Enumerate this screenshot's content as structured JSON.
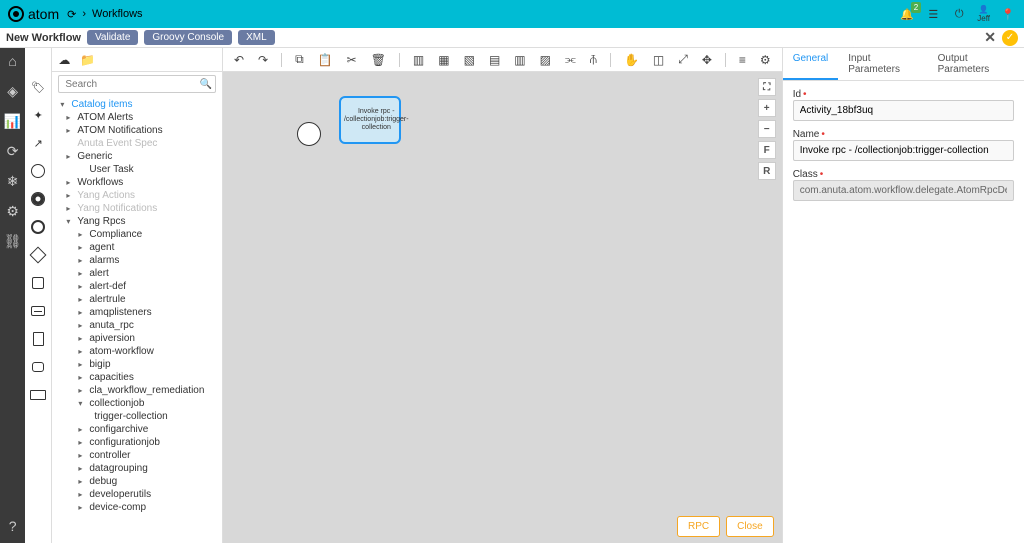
{
  "header": {
    "logo_text": "atom",
    "breadcrumb_sep": "›",
    "breadcrumb_item": "Workflows",
    "notif_count": "2",
    "user_name": "Jeff"
  },
  "tabbar": {
    "title": "New Workflow",
    "btn_validate": "Validate",
    "btn_groovy": "Groovy Console",
    "btn_xml": "XML"
  },
  "search": {
    "placeholder": "Search"
  },
  "tree": {
    "root": "Catalog items",
    "items_lvl1": [
      {
        "label": "ATOM Alerts",
        "caret": "▸"
      },
      {
        "label": "ATOM Notifications",
        "caret": "▸"
      },
      {
        "label": "Anuta Event Spec",
        "caret": "",
        "muted": true
      },
      {
        "label": "Generic",
        "caret": "▸"
      },
      {
        "label": "User Task",
        "caret": "",
        "indent": true
      },
      {
        "label": "Workflows",
        "caret": "▸"
      },
      {
        "label": "Yang Actions",
        "caret": "▸",
        "muted": true
      },
      {
        "label": "Yang Notifications",
        "caret": "▸",
        "muted": true
      },
      {
        "label": "Yang Rpcs",
        "caret": "▾",
        "expanded": true
      }
    ],
    "rpc_items": [
      "Compliance",
      "agent",
      "alarms",
      "alert",
      "alert-def",
      "alertrule",
      "amqplisteners",
      "anuta_rpc",
      "apiversion",
      "atom-workflow",
      "bigip",
      "capacities",
      "cla_workflow_remediation"
    ],
    "collectionjob": "collectionjob",
    "trigger": "trigger-collection",
    "rpc_items2": [
      "configarchive",
      "configurationjob",
      "controller",
      "datagrouping",
      "debug",
      "developerutils",
      "device-comp"
    ]
  },
  "canvas": {
    "task_label": "Invoke rpc - /collectionjob:trigger-collection"
  },
  "zoom": {
    "fullscreen": "⛶",
    "plus": "+",
    "minus": "−",
    "f": "F",
    "r": "R"
  },
  "rpanel": {
    "tab_general": "General",
    "tab_input": "Input Parameters",
    "tab_output": "Output Parameters",
    "id_label": "Id",
    "id_value": "Activity_18bf3uq",
    "name_label": "Name",
    "name_value": "Invoke rpc - /collectionjob:trigger-collection",
    "class_label": "Class",
    "class_value": "com.anuta.atom.workflow.delegate.AtomRpcDelegate"
  },
  "footer": {
    "rpc": "RPC",
    "close": "Close"
  }
}
